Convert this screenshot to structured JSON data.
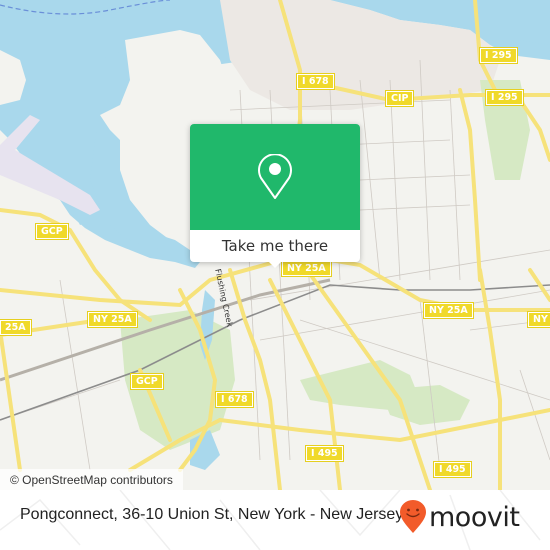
{
  "map": {
    "attribution": "© OpenStreetMap contributors",
    "colors": {
      "water": "#a9d8ec",
      "land": "#f3f3ef",
      "park": "#d6e9c4",
      "road_major": "#f6e27a",
      "shield": "#f0d92a",
      "rail": "#888888",
      "popup_green": "#20b86b",
      "brand_orange": "#f25b2a"
    },
    "shields": [
      {
        "id": "i295-top",
        "text": "I 295"
      },
      {
        "id": "i678-top",
        "text": "I 678"
      },
      {
        "id": "cip",
        "text": "CIP"
      },
      {
        "id": "i295-mid",
        "text": "I 295"
      },
      {
        "id": "gcp-left",
        "text": "GCP"
      },
      {
        "id": "ny25a-popup",
        "text": "NY 25A"
      },
      {
        "id": "ny25a-left",
        "text": "NY 25A"
      },
      {
        "id": "25a-edge",
        "text": "25A"
      },
      {
        "id": "ny25a-right",
        "text": "NY 25A"
      },
      {
        "id": "ny25a-far-right",
        "text": "NY"
      },
      {
        "id": "gcp-bottom",
        "text": "GCP"
      },
      {
        "id": "i678-bottom",
        "text": "I 678"
      },
      {
        "id": "i495-mid",
        "text": "I 495"
      },
      {
        "id": "i495-right",
        "text": "I 495"
      }
    ],
    "street_labels": [
      {
        "id": "flushing-creek",
        "text": "Flushing Creek"
      }
    ]
  },
  "popup": {
    "icon": "map-pin-icon",
    "action_label": "Take me there"
  },
  "footer": {
    "address": "Pongconnect, 36-10 Union St, New York - New Jersey",
    "brand_name": "moovit",
    "brand_icon": "moovit-pin-smile-icon"
  }
}
